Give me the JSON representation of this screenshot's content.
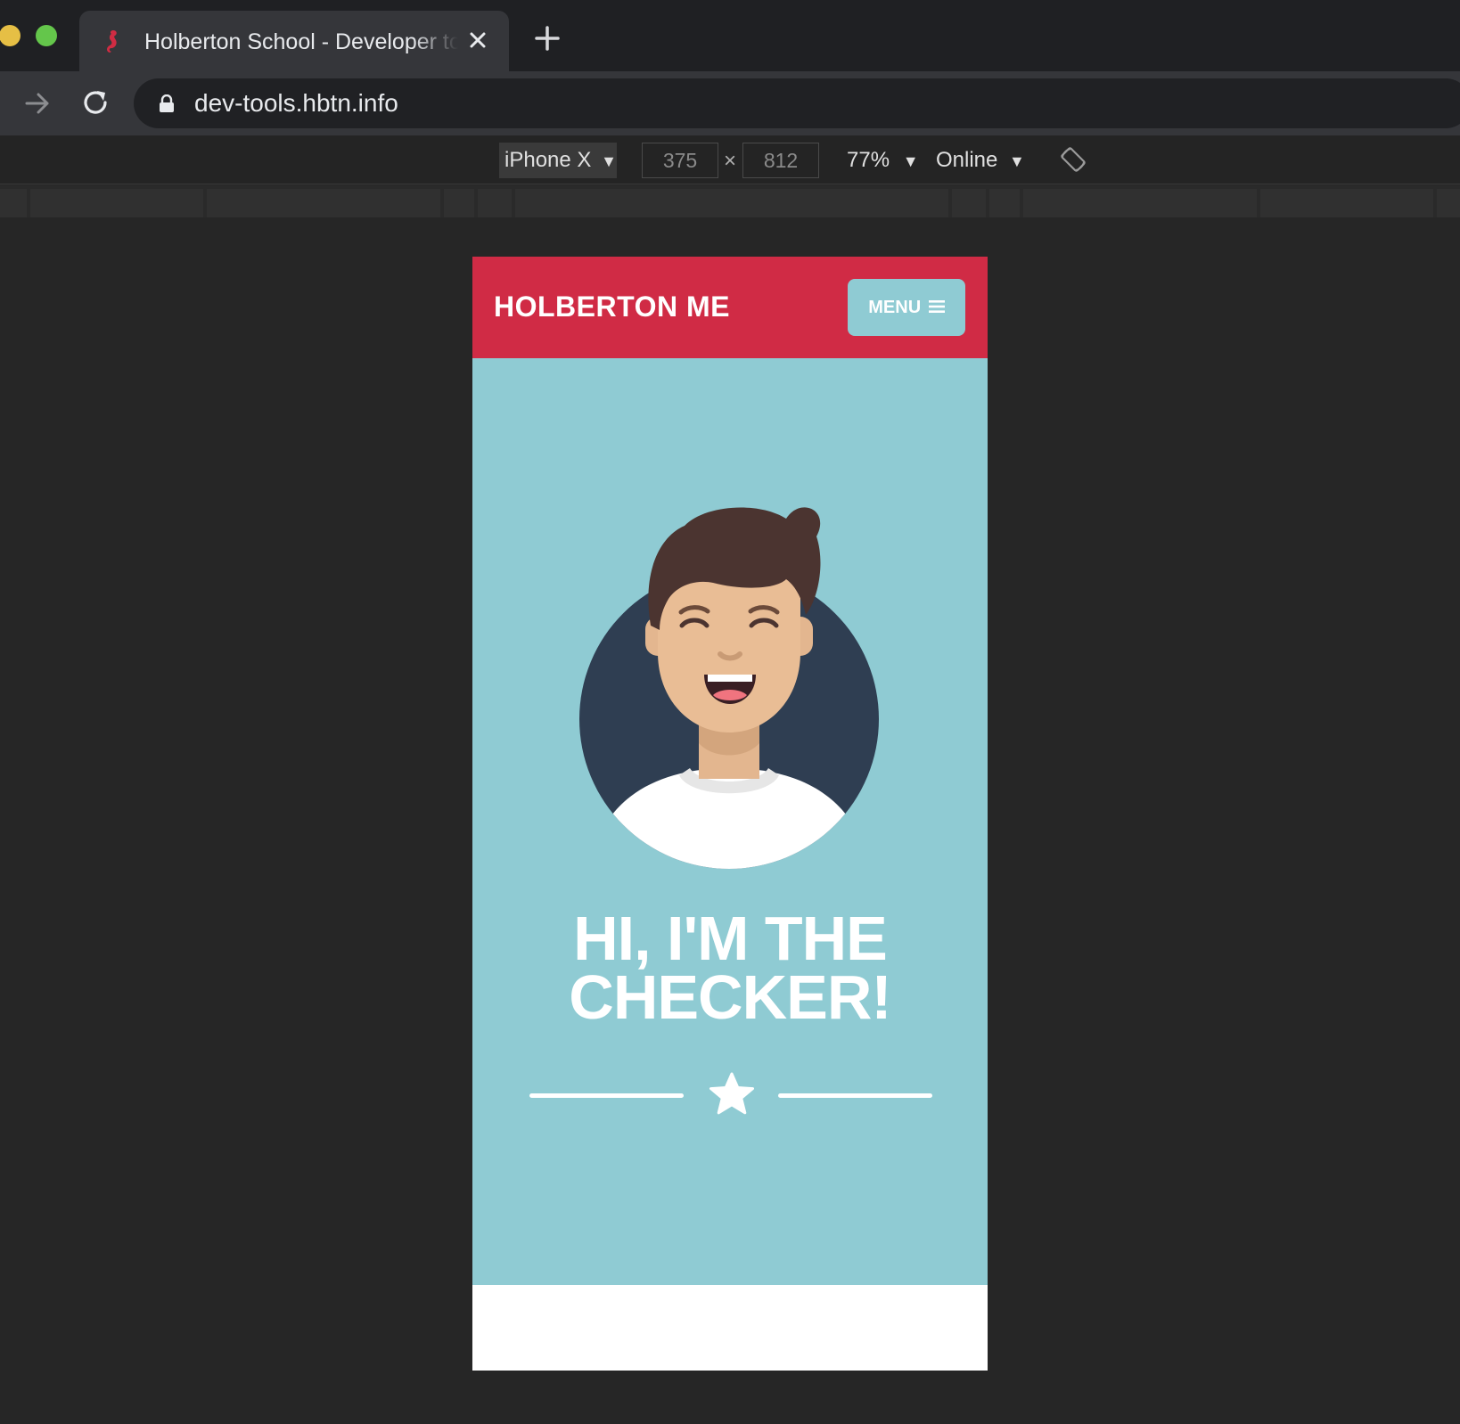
{
  "browser": {
    "tab": {
      "title": "Holberton School - Developer tools"
    },
    "address_bar": {
      "url": "dev-tools.hbtn.info"
    },
    "icons": [
      "forward-arrow-icon",
      "reload-icon",
      "lock-icon",
      "close-icon",
      "plus-icon",
      "favicon"
    ]
  },
  "device_toolbar": {
    "device": "iPhone X",
    "width": "375",
    "height": "812",
    "times": "×",
    "zoom": "77%",
    "network": "Online",
    "caret": "▼"
  },
  "page": {
    "logo": "HOLBERTON ME",
    "menu_label": "MENU",
    "hero_title_line1": "HI, I'M THE",
    "hero_title_line2": "CHECKER!",
    "colors": {
      "header": "#d02b45",
      "hero": "#8fcbd3",
      "avatar_bg": "#2f3e52",
      "text": "#ffffff"
    }
  }
}
